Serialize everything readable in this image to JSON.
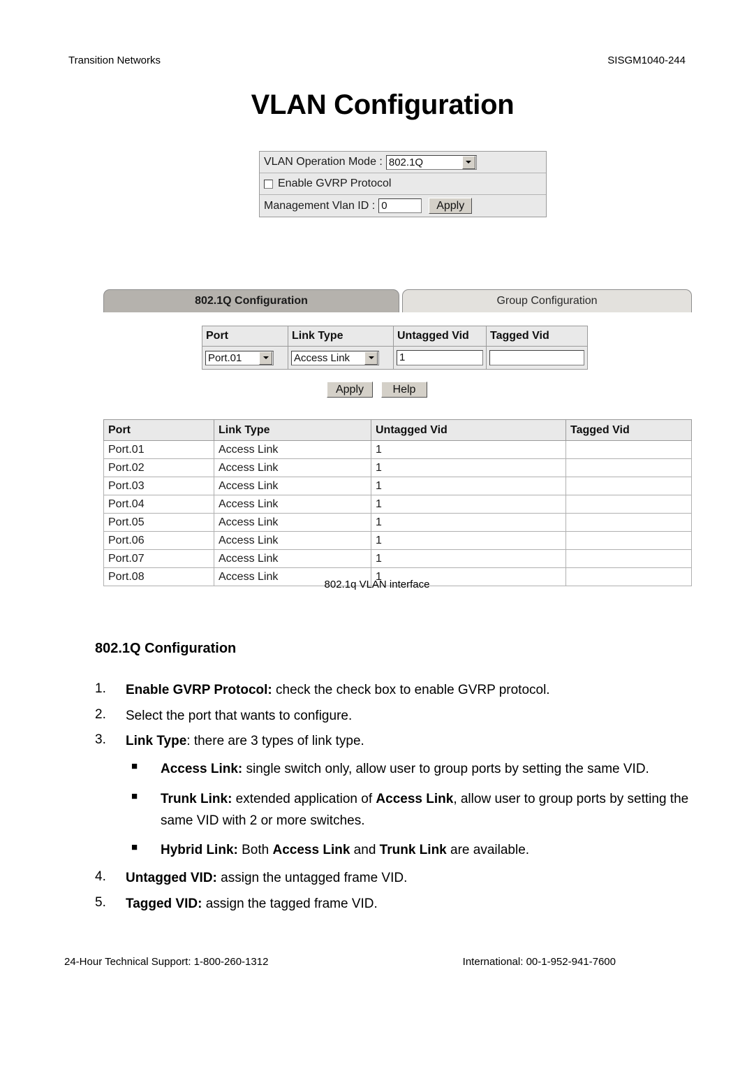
{
  "page": {
    "header_left": "Transition Networks",
    "header_right": "SISGM1040-244",
    "footer_left": "24-Hour Technical Support: 1-800-260-1312",
    "footer_right": "International: 00-1-952-941-7600"
  },
  "screenshot": {
    "title": "VLAN Configuration",
    "caption": "802.1q VLAN interface",
    "operation_panel": {
      "mode_label": "VLAN Operation Mode :",
      "mode_value": "802.1Q",
      "gvrp_label": "Enable GVRP Protocol",
      "gvrp_checked": false,
      "mgmt_label": "Management Vlan ID :",
      "mgmt_value": "0",
      "apply_label": "Apply"
    },
    "tabs": [
      {
        "label": "802.1Q Configuration",
        "active": true
      },
      {
        "label": "Group Configuration",
        "active": false
      }
    ],
    "edit_form": {
      "headers": [
        "Port",
        "Link Type",
        "Untagged Vid",
        "Tagged Vid"
      ],
      "port_value": "Port.01",
      "link_type_value": "Access Link",
      "untagged_vid_value": "1",
      "tagged_vid_value": ""
    },
    "buttons": {
      "apply_label": "Apply",
      "help_label": "Help"
    },
    "list_table": {
      "headers": [
        "Port",
        "Link Type",
        "Untagged Vid",
        "Tagged Vid"
      ],
      "rows": [
        {
          "port": "Port.01",
          "link_type": "Access Link",
          "untagged_vid": "1",
          "tagged_vid": ""
        },
        {
          "port": "Port.02",
          "link_type": "Access Link",
          "untagged_vid": "1",
          "tagged_vid": ""
        },
        {
          "port": "Port.03",
          "link_type": "Access Link",
          "untagged_vid": "1",
          "tagged_vid": ""
        },
        {
          "port": "Port.04",
          "link_type": "Access Link",
          "untagged_vid": "1",
          "tagged_vid": ""
        },
        {
          "port": "Port.05",
          "link_type": "Access Link",
          "untagged_vid": "1",
          "tagged_vid": ""
        },
        {
          "port": "Port.06",
          "link_type": "Access Link",
          "untagged_vid": "1",
          "tagged_vid": ""
        },
        {
          "port": "Port.07",
          "link_type": "Access Link",
          "untagged_vid": "1",
          "tagged_vid": ""
        },
        {
          "port": "Port.08",
          "link_type": "Access Link",
          "untagged_vid": "1",
          "tagged_vid": ""
        }
      ]
    }
  },
  "doc": {
    "heading": "802.1Q Configuration",
    "item1_num": "1.",
    "item1_bold": "Enable GVRP Protocol:",
    "item1_rest": " check the check box to enable GVRP protocol.",
    "item2_num": "2.",
    "item2_text": "Select the port that wants to configure.",
    "item3_num": "3.",
    "item3_bold": "Link Type",
    "item3_rest": ": there are 3 types of link type.",
    "bullet_marker": "■",
    "bullet1_bold": "Access Link:",
    "bullet1_rest": " single switch only, allow user to group ports by setting the same VID.",
    "bullet2_bold": "Trunk Link:",
    "bullet2_mid": " extended application of ",
    "bullet2_bold2": "Access Link",
    "bullet2_rest": ", allow user to group ports by setting the same VID with 2 or more switches.",
    "bullet3_bold": "Hybrid Link:",
    "bullet3_mid": " Both ",
    "bullet3_bold2": "Access Link",
    "bullet3_mid2": " and ",
    "bullet3_bold3": "Trunk Link",
    "bullet3_rest": " are available.",
    "item4_num": "4.",
    "item4_bold": "Untagged VID:",
    "item4_rest": " assign the untagged frame VID.",
    "item5_num": "5.",
    "item5_bold": "Tagged VID:",
    "item5_rest": " assign the tagged frame VID."
  }
}
